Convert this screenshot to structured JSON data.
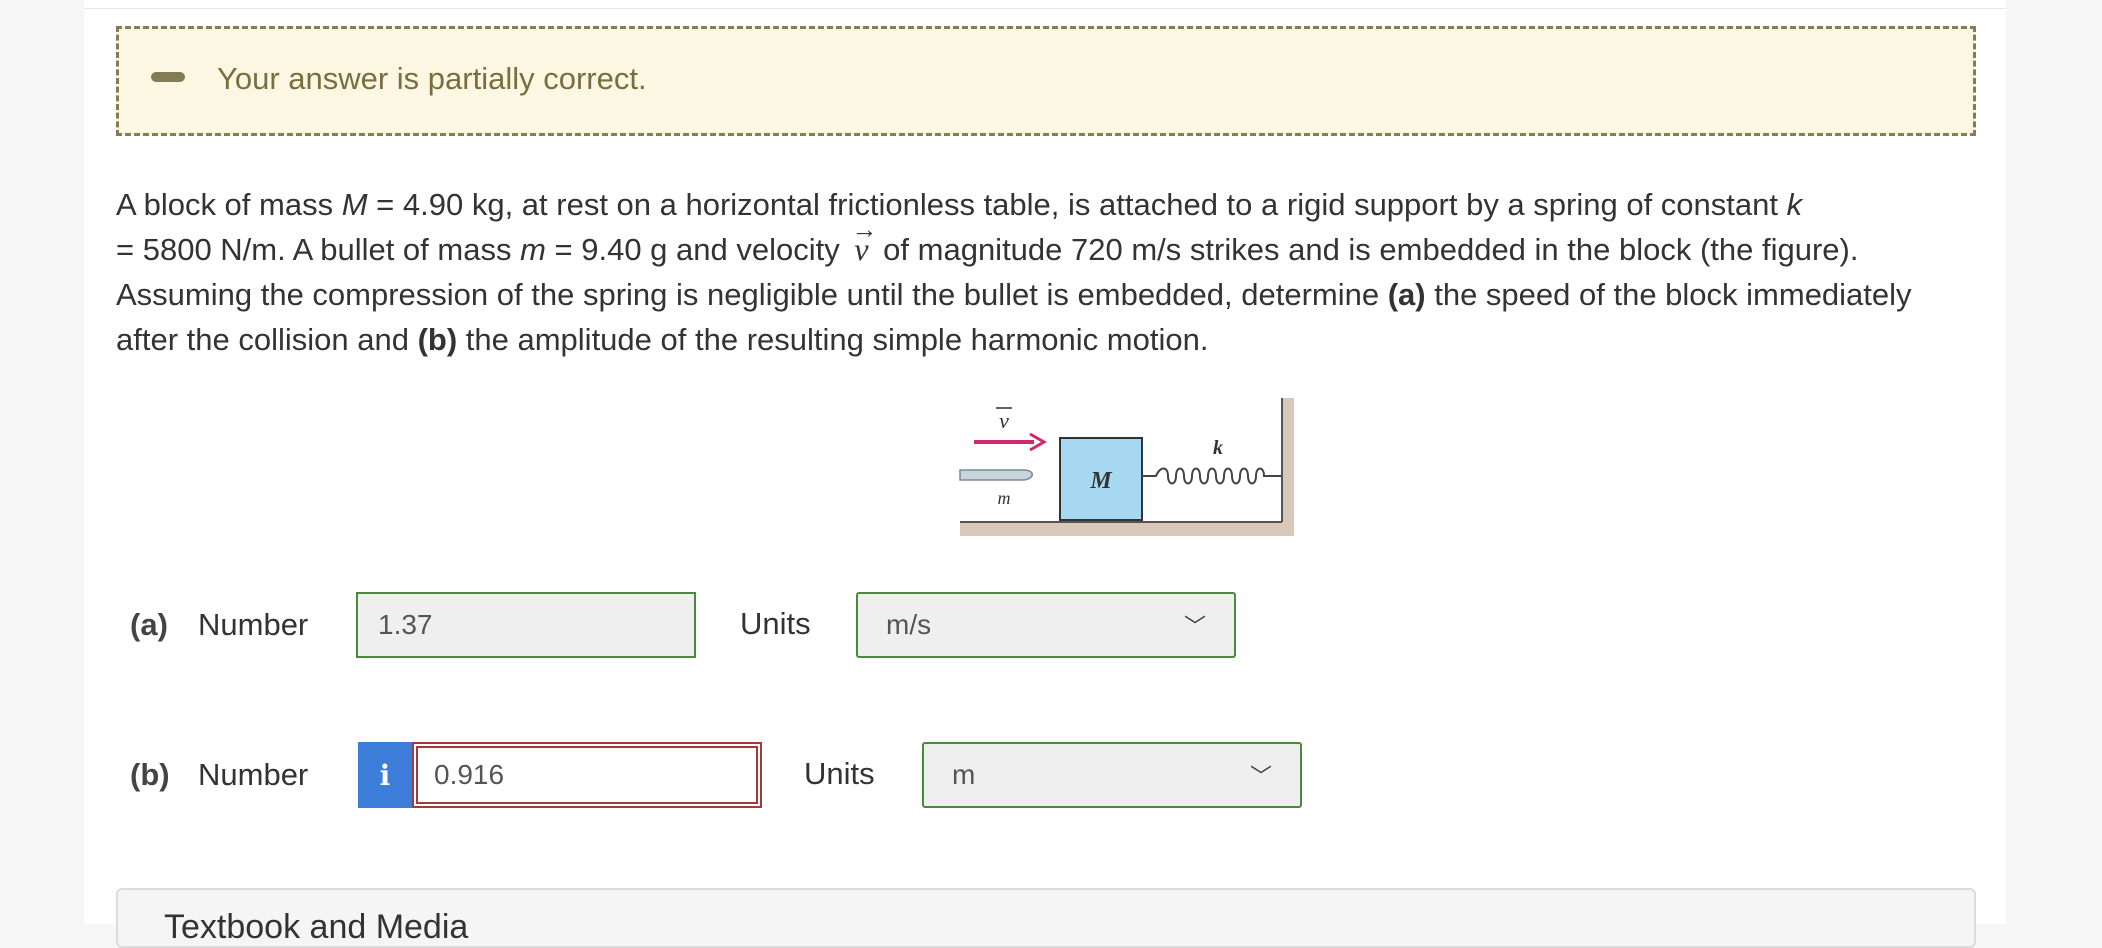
{
  "feedback": {
    "message": "Your answer is partially correct.",
    "icon": "minus-icon",
    "accent_color": "#857c54",
    "background_color": "#fbf7e2"
  },
  "question": {
    "line1_pre": "A block of mass ",
    "line1_M": "M",
    "line1_mid": " = 4.90 kg, at rest on a horizontal frictionless table, is attached to a rigid support by a spring of constant ",
    "line1_k": "k",
    "line2_pre": "= 5800 N/m. A bullet of mass ",
    "line2_m": "m",
    "line2_mid": " = 9.40 g and velocity ",
    "vector_symbol": "v",
    "vector_arrow": "→",
    "line2_post": " of magnitude 720 m/s strikes and is embedded in the block (the figure).",
    "line3_pre": "Assuming the compression of the spring is negligible until the bullet is embedded, determine ",
    "part_a_tag": "(a)",
    "line3_post": " the speed of the block immediately",
    "line4_pre": "after the collision and ",
    "part_b_tag": "(b)",
    "line4_post": " the amplitude of the resulting simple harmonic motion."
  },
  "figure": {
    "velocity_label": "v",
    "bullet_label": "m",
    "block_label": "M",
    "spring_label": "k"
  },
  "part_a": {
    "tag": "(a)",
    "number_label": "Number",
    "value": "1.37",
    "units_label": "Units",
    "units_value": "m/s",
    "status_color": "#4a8a3d"
  },
  "part_b": {
    "tag": "(b)",
    "number_label": "Number",
    "info_glyph": "i",
    "value": "0.916",
    "units_label": "Units",
    "units_value": "m",
    "status_color": "#a23a3a"
  },
  "bottom_panel": {
    "title": "Textbook and Media"
  }
}
